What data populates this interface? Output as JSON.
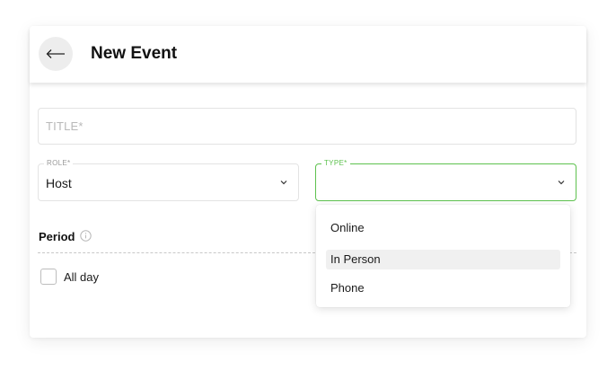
{
  "header": {
    "title": "New Event",
    "back_icon": "arrow-left-icon"
  },
  "form": {
    "title_field": {
      "placeholder": "TITLE*",
      "value": ""
    },
    "role_field": {
      "label": "ROLE*",
      "value": "Host"
    },
    "type_field": {
      "label": "TYPE*",
      "value": "",
      "state": "focused"
    },
    "period": {
      "heading": "Period",
      "info_icon": "info-icon"
    },
    "all_day": {
      "label": "All day",
      "checked": false
    }
  },
  "type_menu": {
    "options": [
      "Online",
      "In Person",
      "Phone"
    ],
    "highlighted_index": 1
  },
  "colors": {
    "accent": "#5ec24f",
    "border": "#e3e3e3",
    "placeholder": "#b9b9b9",
    "highlight": "#f0f0f0"
  }
}
